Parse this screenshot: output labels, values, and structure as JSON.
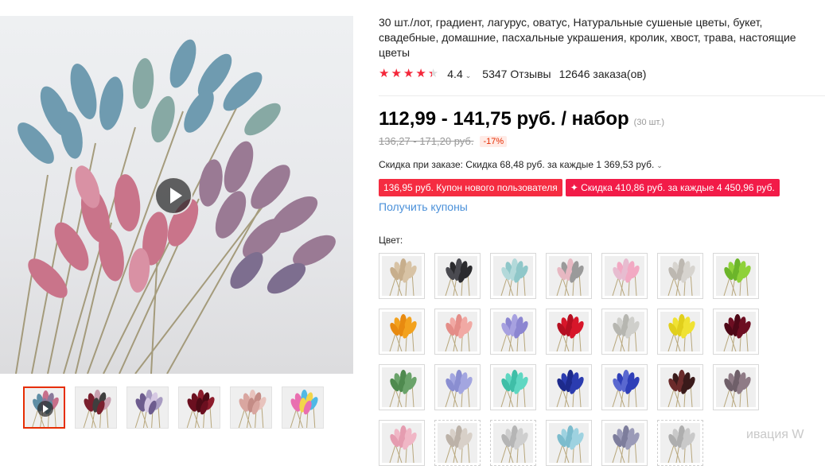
{
  "product": {
    "title": "30 шт./лот, градиент, лагурус, оватус, Натуральные сушеные цветы, букет, свадебные, домашние, пасхальные украшения, кролик, хвост, трава, настоящие цветы",
    "rating": "4.4",
    "rating_caret": "⌄",
    "reviews": "5347 Отзывы",
    "orders": "12646 заказа(ов)",
    "price": "112,99 - 141,75 руб. / набор",
    "price_unit": "(30 шт.)",
    "old_price": "136,27 - 171,20 руб.",
    "discount": "-17%",
    "bulk_discount": "Скидка при заказе: Скидка 68,48 руб. за каждые 1 369,53 руб.",
    "bulk_caret": "⌄",
    "coupon_new_user": "136,95 руб. Купон нового пользователя",
    "coupon_bulk": "✦ Скидка 410,86 руб. за каждые 4 450,96 руб.",
    "get_coupons": "Получить купоны",
    "color_label": "Цвет:"
  },
  "rating_stars": {
    "filled": 4.4,
    "max": 5
  },
  "watermark": "ивация W",
  "colors": {
    "accent": "#f52c41",
    "link": "#4a90d9",
    "star": "#f4273a"
  },
  "gallery": {
    "thumbnails": [
      {
        "name": "thumb-video",
        "colors": [
          "#5f8ea5",
          "#c76f8a",
          "#8a7a9a"
        ],
        "has_play": true
      },
      {
        "name": "thumb-2",
        "colors": [
          "#7a1f2e",
          "#c9a0b0",
          "#3e3e3e"
        ]
      },
      {
        "name": "thumb-3",
        "colors": [
          "#6d5c8e",
          "#a89cc2",
          "#d6c9e3"
        ]
      },
      {
        "name": "thumb-4",
        "colors": [
          "#6b0f1f",
          "#8d1c2c",
          "#4d0a15"
        ]
      },
      {
        "name": "thumb-5",
        "colors": [
          "#d9a6a0",
          "#e8c3bd",
          "#c48c86"
        ]
      },
      {
        "name": "thumb-6",
        "colors": [
          "#e96fb0",
          "#4fb9e6",
          "#f2d54a"
        ]
      }
    ]
  },
  "swatches": [
    {
      "colors": [
        "#d8c3a5",
        "#c7ae8c"
      ]
    },
    {
      "colors": [
        "#2b2b2e",
        "#4a4a50"
      ]
    },
    {
      "colors": [
        "#8fc7c9",
        "#b3d9da"
      ]
    },
    {
      "colors": [
        "#9a9a9a",
        "#e7b8c2"
      ]
    },
    {
      "colors": [
        "#f2a9c3",
        "#e7bcd0"
      ]
    },
    {
      "colors": [
        "#d7d4cf",
        "#bdb8b1"
      ]
    },
    {
      "colors": [
        "#8fd13a",
        "#6cb52a"
      ]
    },
    {
      "colors": [
        "#f3a21e",
        "#e88a10"
      ]
    },
    {
      "colors": [
        "#f1a9a4",
        "#e48d88"
      ]
    },
    {
      "colors": [
        "#8c86d1",
        "#a7a1e0"
      ]
    },
    {
      "colors": [
        "#d7162a",
        "#b50f21"
      ]
    },
    {
      "colors": [
        "#cfcfcb",
        "#b6b6b0"
      ]
    },
    {
      "colors": [
        "#f0e233",
        "#e1cf1c"
      ]
    },
    {
      "colors": [
        "#6d0e22",
        "#4e0817"
      ]
    },
    {
      "colors": [
        "#6aa36a",
        "#4f8a4f"
      ]
    },
    {
      "colors": [
        "#a3a6e0",
        "#8a8ed1"
      ]
    },
    {
      "colors": [
        "#5fd7c2",
        "#3fbea7"
      ]
    },
    {
      "colors": [
        "#2b3cb0",
        "#1d2a8c"
      ]
    },
    {
      "colors": [
        "#2f3fb8",
        "#5a68d0"
      ]
    },
    {
      "colors": [
        "#3a1a1a",
        "#6b2b2b"
      ]
    },
    {
      "colors": [
        "#8f7b86",
        "#6f5f69"
      ]
    },
    {
      "colors": [
        "#f0b7c6",
        "#e59cb0"
      ],
      "dashed": false
    },
    {
      "colors": [
        "#d8d0c8",
        "#bcb2a8"
      ],
      "dashed": true
    },
    {
      "colors": [
        "#cfcfcf",
        "#b5b5b5"
      ],
      "dashed": true
    },
    {
      "colors": [
        "#9ed2e0",
        "#7cbccd"
      ],
      "dashed": false
    },
    {
      "colors": [
        "#9b9bb8",
        "#7d7d9c"
      ],
      "dashed": false
    },
    {
      "colors": [
        "#c9c9c9",
        "#aeaeae"
      ],
      "dashed": true
    }
  ]
}
